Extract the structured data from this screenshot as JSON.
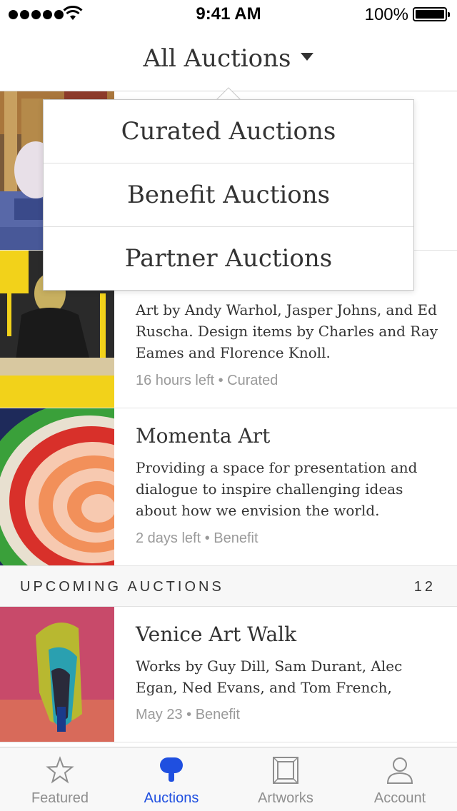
{
  "status_bar": {
    "time": "9:41 AM",
    "battery": "100%"
  },
  "nav": {
    "title": "All Auctions"
  },
  "dropdown": {
    "options": [
      "Curated Auctions",
      "Benefit Auctions",
      "Partner Auctions"
    ]
  },
  "auctions": [
    {
      "title": "",
      "description": "",
      "meta": ""
    },
    {
      "description": "Art by Andy Warhol, Jasper Johns, and Ed Ruscha. Design items by Charles and Ray Eames and Florence Knoll.",
      "meta": "16 hours left • Curated"
    },
    {
      "title": "Momenta Art",
      "description": "Providing a space for presentation and dialogue to inspire challenging ideas about how we envision the world.",
      "meta": "2 days left • Benefit"
    }
  ],
  "upcoming": {
    "label": "UPCOMING AUCTIONS",
    "count": "12",
    "items": [
      {
        "title": "Venice Art Walk",
        "description": "Works by Guy Dill, Sam Durant, Alec Egan, Ned Evans, and Tom French,",
        "meta": "May 23 • Benefit"
      }
    ]
  },
  "tabs": [
    {
      "label": "Featured",
      "icon": "star-icon",
      "active": false
    },
    {
      "label": "Auctions",
      "icon": "paddle-icon",
      "active": true
    },
    {
      "label": "Artworks",
      "icon": "frame-icon",
      "active": false
    },
    {
      "label": "Account",
      "icon": "person-icon",
      "active": false
    }
  ],
  "colors": {
    "accent": "#1f4fe0",
    "inactive_tab": "#8e8e8e",
    "meta_text": "#9a9a9a"
  }
}
